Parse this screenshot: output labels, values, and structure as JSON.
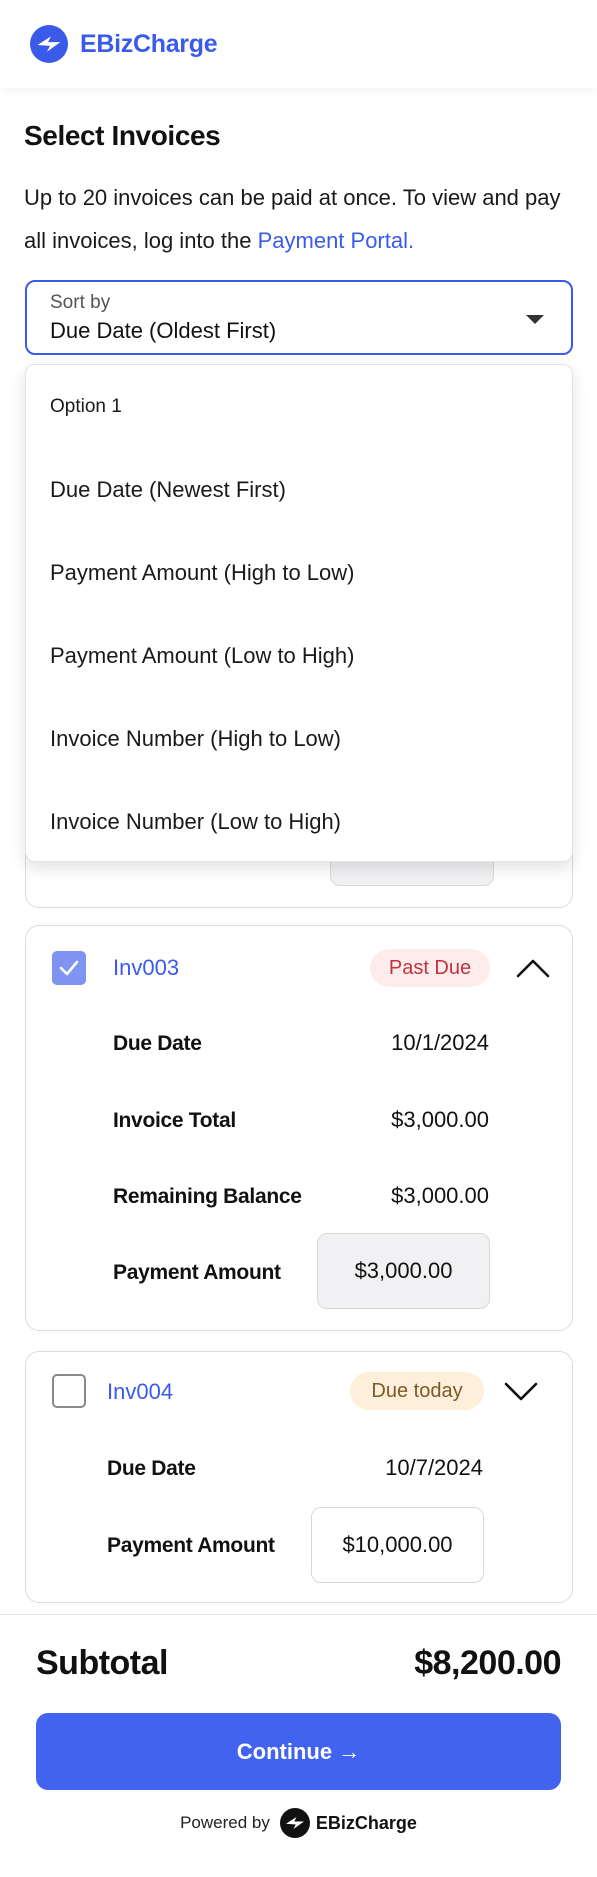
{
  "brand": {
    "name": "EBizCharge",
    "color": "#3a5bea"
  },
  "page": {
    "title": "Select Invoices",
    "intro_text": "Up to 20 invoices can be paid at once. To view and pay all invoices, log into the",
    "intro_link": "Payment Portal."
  },
  "sort": {
    "label": "Sort by",
    "value": "Due Date (Oldest First)",
    "options": [
      "Option 1",
      "Due Date (Newest First)",
      "Payment Amount (High to Low)",
      "Payment Amount (Low to High)",
      "Invoice Number (High to Low)",
      "Invoice Number (Low to High)"
    ]
  },
  "invoices": [
    {
      "number": "Inv003",
      "checked": true,
      "status": "Past Due",
      "expanded": true,
      "rows": [
        {
          "label": "Due Date",
          "value": "10/1/2024"
        },
        {
          "label": "Invoice Total",
          "value": "$3,000.00"
        },
        {
          "label": "Remaining Balance",
          "value": "$3,000.00"
        }
      ],
      "payment_label": "Payment Amount",
      "payment_amount": "$3,000.00"
    },
    {
      "number": "Inv004",
      "checked": false,
      "status": "Due today",
      "expanded": false,
      "rows": [
        {
          "label": "Due Date",
          "value": "10/7/2024"
        }
      ],
      "payment_label": "Payment Amount",
      "payment_amount": "$10,000.00"
    }
  ],
  "footer": {
    "subtotal_label": "Subtotal",
    "subtotal_value": "$8,200.00",
    "continue_label": "Continue →",
    "powered_by": "Powered by",
    "powered_brand": "EBizCharge"
  },
  "icons": {
    "logo": "ebizcharge-logo-icon",
    "caret": "caret-down-icon",
    "check": "checkmark-icon",
    "chevron_up": "chevron-up-icon",
    "chevron_down": "chevron-down-icon"
  }
}
